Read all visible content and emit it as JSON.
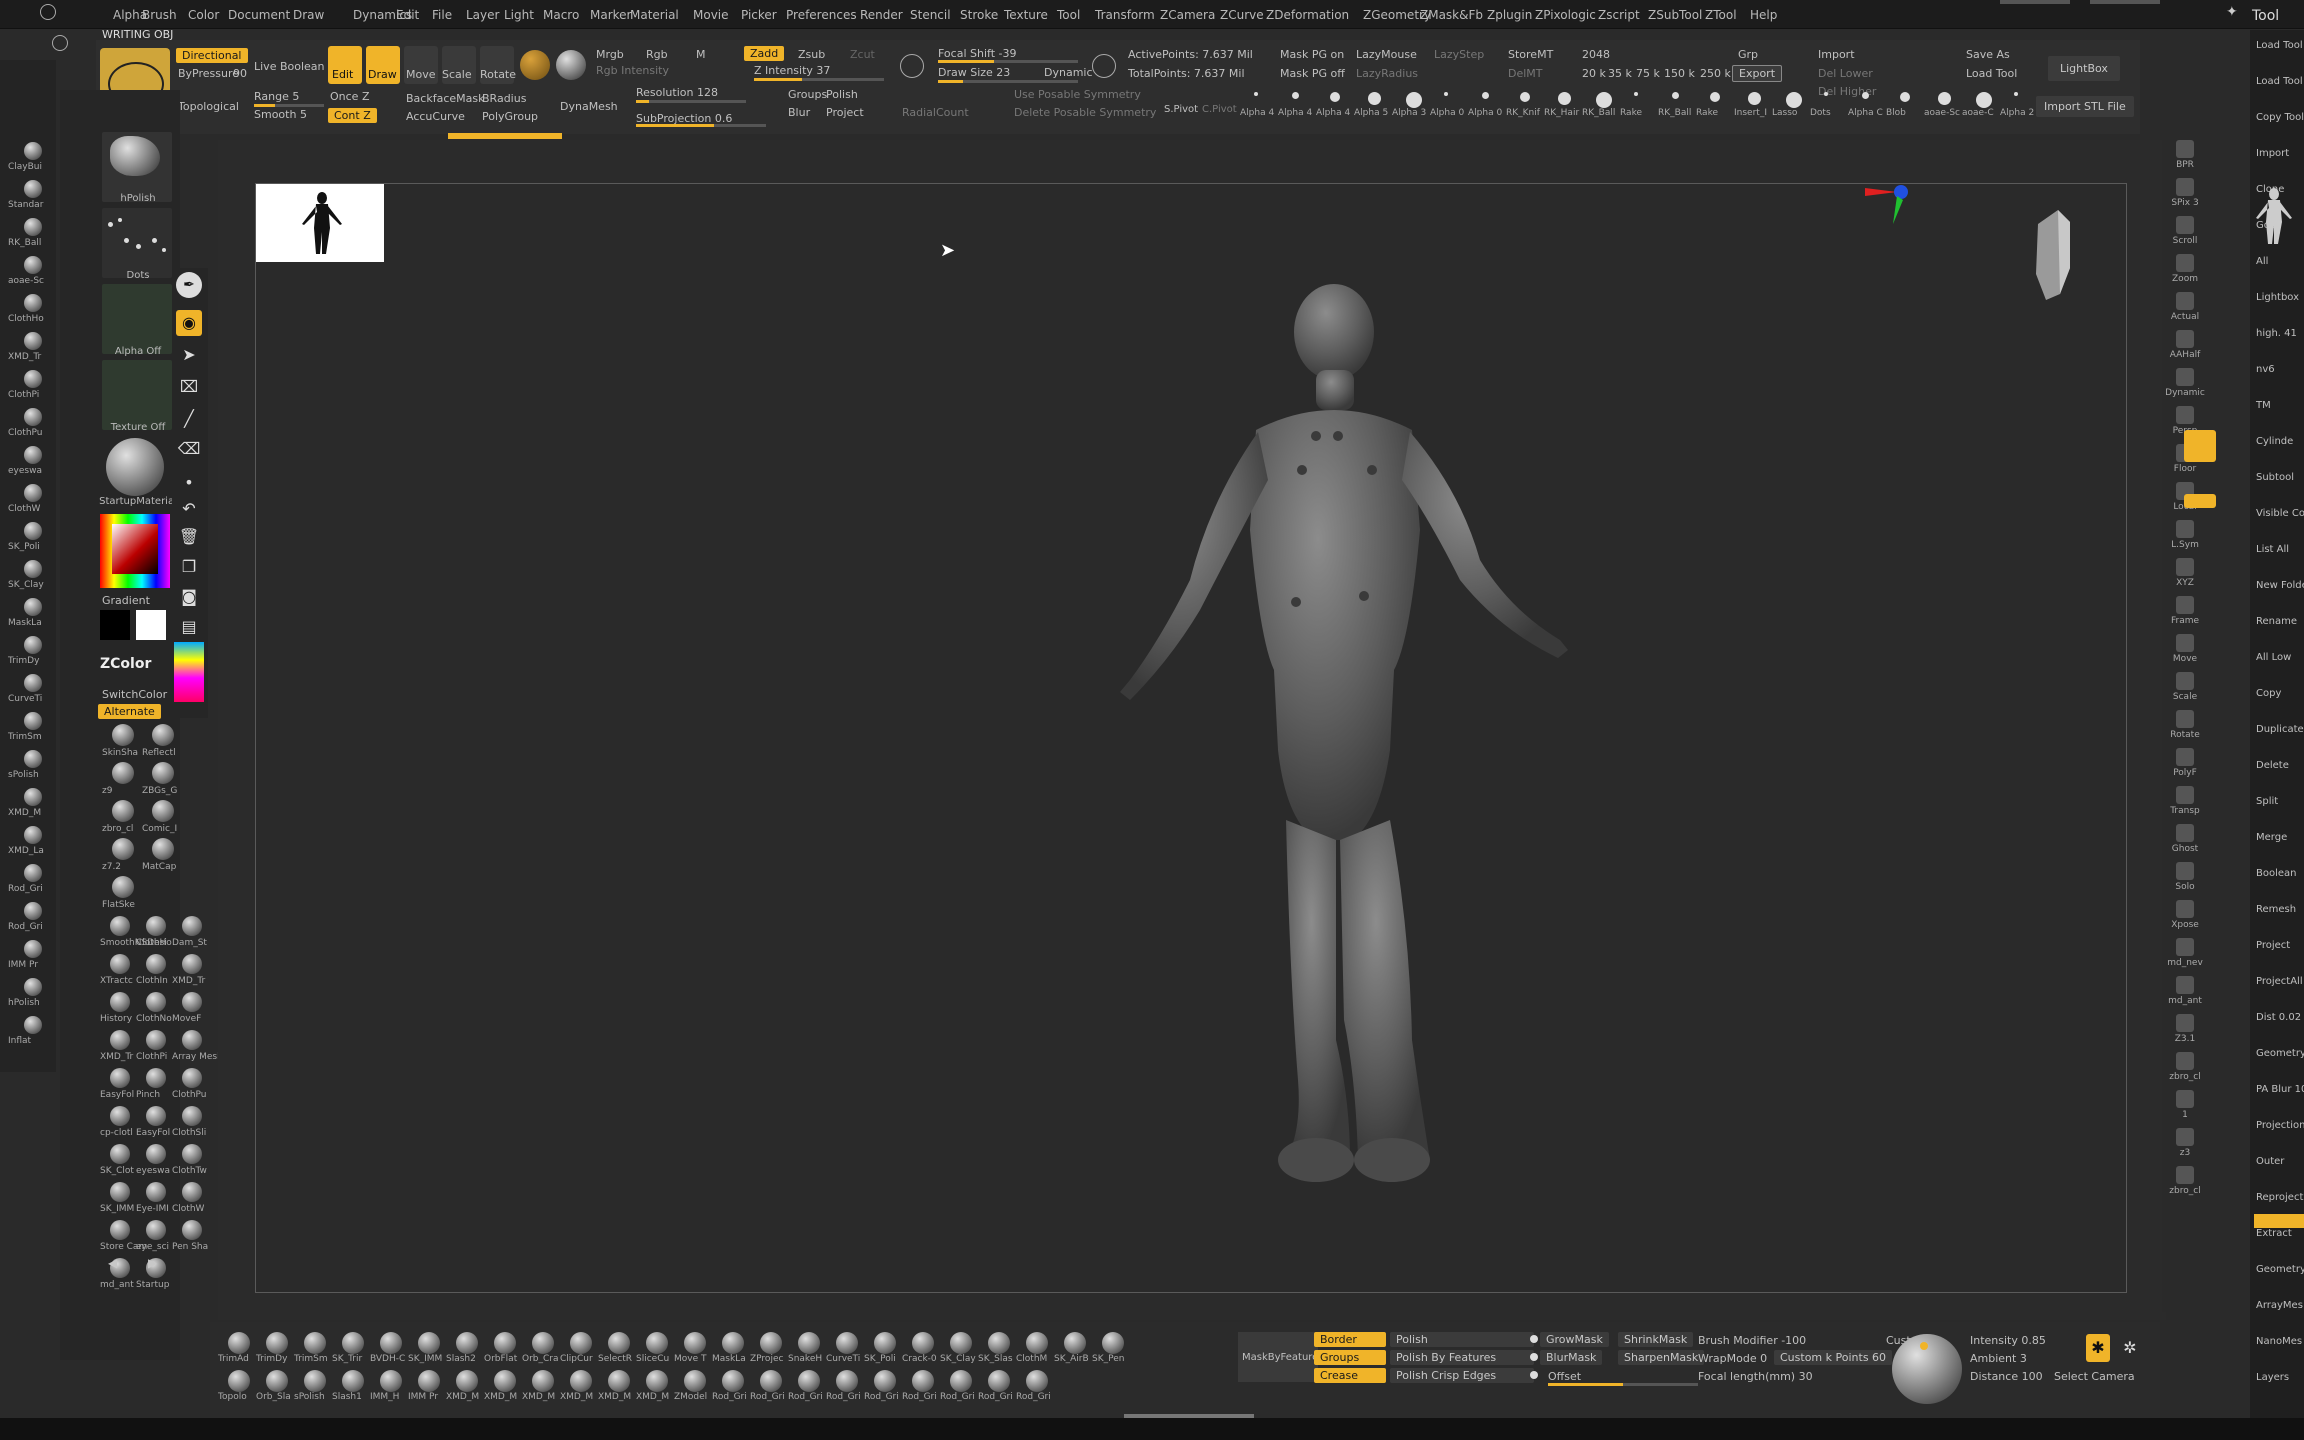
{
  "menu": [
    "Alpha",
    "Brush",
    "Color",
    "Document",
    "Draw",
    "Dynamics",
    "Edit",
    "File",
    "Layer",
    "Light",
    "Macro",
    "Marker",
    "Material",
    "Movie",
    "Picker",
    "Preferences",
    "Render",
    "Stencil",
    "Stroke",
    "Texture",
    "Tool",
    "Transform",
    "ZCamera",
    "ZCurve",
    "ZDeformation",
    "ZGeometry",
    "ZMask&Fb",
    "Zplugin",
    "ZPixologic",
    "Zscript",
    "ZSubTool",
    "ZTool",
    "Help"
  ],
  "tool_title": "Tool",
  "subtitle": "WRITING OBJ",
  "shelf": {
    "directional": "Directional",
    "bypressure": "ByPressure",
    "bypressure_val": "90",
    "live_boolean": "Live Boolean",
    "edit": "Edit",
    "draw": "Draw",
    "move": "Move",
    "scale": "Scale",
    "rotate": "Rotate",
    "mrgb": "Mrgb",
    "rgb": "Rgb",
    "m": "M",
    "rgb_intensity": "Rgb Intensity",
    "zadd": "Zadd",
    "zsub": "Zsub",
    "zcut": "Zcut",
    "z_intensity": "Z Intensity 37",
    "focal_shift": "Focal Shift -39",
    "draw_size": "Draw Size 23",
    "dynamic": "Dynamic",
    "active_points": "ActivePoints: 7.637 Mil",
    "total_points": "TotalPoints: 7.637 Mil",
    "mask_pg_on": "Mask PG on",
    "mask_pg_off": "Mask PG off",
    "lazymouse": "LazyMouse",
    "lazyradius": "LazyRadius",
    "lazystep": "LazyStep",
    "storemt": "StoreMT",
    "delmt": "DelMT",
    "res_2048": "2048",
    "grp": "Grp",
    "import": "Import",
    "export": "Export",
    "save_as": "Save As",
    "load_tool": "Load Tool",
    "lightbox": "LightBox",
    "del_lower": "Del Lower",
    "del_higher": "Del Higher",
    "counts": [
      "20 k",
      "35 k",
      "75 k",
      "150 k",
      "250 k"
    ],
    "topological": "Topological",
    "range": "Range 5",
    "smooth": "Smooth 5",
    "once_z": "Once Z",
    "cont_z": "Cont Z",
    "backface_mask": "BackfaceMask",
    "bradius": "BRadius",
    "accucurve": "AccuCurve",
    "polygroup": "PolyGroup",
    "dynamesh": "DynaMesh",
    "resolution": "Resolution 128",
    "subprojection": "SubProjection 0.6",
    "groups": "Groups",
    "polish": "Polish",
    "blur": "Blur",
    "project": "Project",
    "radial_count": "RadialCount",
    "use_posable_symmetry": "Use Posable Symmetry",
    "delete_posable_symmetry": "Delete Posable Symmetry",
    "spivot": "S.Pivot",
    "cpivot": "C.Pivot",
    "import_stl": "Import STL File",
    "alphas": [
      "Alpha 4",
      "Alpha 4",
      "Alpha 4",
      "Alpha 5",
      "Alpha 3",
      "Alpha 0",
      "Alpha 0",
      "RK_Knif",
      "RK_Hair",
      "RK_Ball",
      "Rake",
      "RK_Ball",
      "Rake",
      "Insert_I",
      "Lasso",
      "Dots",
      "Alpha C",
      "Blob",
      "aoae-Sc",
      "aoae-C",
      "Alpha 2"
    ]
  },
  "left": {
    "hpolish": "hPolish",
    "dots": "Dots",
    "alpha_off": "Alpha Off",
    "texture_off": "Texture Off",
    "startup_material": "StartupMaterial",
    "gradient": "Gradient",
    "switchcolor": "SwitchColor",
    "alternate": "Alternate",
    "zcolor": "ZColor",
    "materials": [
      "SkinSha",
      "Reflectl",
      "z9",
      "ZBGs_G",
      "zbro_cl",
      "Comic_I",
      "z7.2",
      "MatCap",
      "FlatSke"
    ],
    "brushes": [
      "SmoothNSDesi",
      "ClothHo",
      "Dam_St",
      "XTractc",
      "ClothIn",
      "XMD_Tr",
      "History",
      "ClothNo",
      "MoveF",
      "XMD_Tr",
      "ClothPi",
      "Array Mesh",
      "EasyFol",
      "Pinch",
      "ClothPu",
      "cp-clotl",
      "EasyFol",
      "ClothSli",
      "SK_Clot",
      "eyeswa",
      "ClothTw",
      "SK_IMM",
      "Eye-IMI",
      "ClothW",
      "Store Cam",
      "eye_sci",
      "Pen Sha",
      "md_ant",
      "Startup"
    ],
    "farleft": [
      "ClayBui",
      "Standar",
      "RK_Ball",
      "aoae-Sc",
      "ClothHo",
      "XMD_Tr",
      "ClothPi",
      "ClothPu",
      "eyeswa",
      "ClothW",
      "SK_Poli",
      "SK_Clay",
      "MaskLa",
      "TrimDy",
      "CurveTi",
      "TrimSm",
      "sPolish",
      "XMD_M",
      "XMD_La",
      "Rod_Gri",
      "Rod_Gri",
      "IMM Pr",
      "hPolish",
      "Inflat"
    ]
  },
  "right_tools": [
    "BPR",
    "SPix 3",
    "Scroll",
    "Zoom",
    "Actual",
    "AAHalf",
    "Dynamic",
    "Persp",
    "Floor",
    "Local",
    "L.Sym",
    "XYZ",
    "Frame",
    "Move",
    "Scale",
    "Rotate",
    "PolyF",
    "Transp",
    "Ghost",
    "Solo",
    "Xpose",
    "md_nev",
    "md_ant",
    "Z3.1",
    "zbro_cl",
    "1",
    "z3",
    "zbro_cl"
  ],
  "right_panel": [
    "Load Tool",
    "Load Tool",
    "Copy Tool",
    "Import",
    "Clone",
    "GoZ",
    "All",
    "Lightbox",
    "high. 41",
    "nv6",
    "TM",
    "Cylinde",
    "Subtool",
    "Visible Co",
    "List All",
    "New Folde",
    "Rename",
    "All Low",
    "Copy",
    "Duplicate",
    "Delete",
    "Split",
    "Merge",
    "Boolean",
    "Remesh",
    "Project",
    "ProjectAll",
    "Dist 0.02",
    "Geometry",
    "PA Blur 10",
    "Projection",
    "Outer",
    "Reproject",
    "Extract",
    "Geometry",
    "ArrayMes",
    "NanoMes",
    "Layers"
  ],
  "bottom": {
    "brushes_row1": [
      "TrimAd",
      "TrimDy",
      "TrimSm",
      "SK_Trir",
      "BVDH-C",
      "SK_IMM",
      "Slash2",
      "OrbFlat",
      "Orb_Cra",
      "ClipCur",
      "SelectR",
      "SliceCu",
      "Move T",
      "MaskLa",
      "ZProjec",
      "SnakeH",
      "CurveTi",
      "SK_Poli",
      "Crack-0",
      "SK_Clay",
      "SK_Slas",
      "ClothM",
      "SK_AirB",
      "SK_Pen"
    ],
    "brushes_row2": [
      "Topolo",
      "Orb_Sla",
      "sPolish",
      "Slash1",
      "IMM_H",
      "IMM Pr",
      "XMD_M",
      "XMD_M",
      "XMD_M",
      "XMD_M",
      "XMD_M",
      "XMD_M",
      "ZModel",
      "Rod_Gri",
      "Rod_Gri",
      "Rod_Gri",
      "Rod_Gri",
      "Rod_Gri",
      "Rod_Gri",
      "Rod_Gri",
      "Rod_Gri",
      "Rod_Gri"
    ],
    "maskbyfeature": "MaskByFeature",
    "border": "Border",
    "groups": "Groups",
    "crease": "Crease",
    "polish": "Polish",
    "polish_by_features": "Polish By Features",
    "polish_crisp_edges": "Polish Crisp Edges",
    "growmask": "GrowMask",
    "shrinkmask": "ShrinkMask",
    "blurmask": "BlurMask",
    "sharpenmask": "SharpenMask",
    "offset": "Offset",
    "brush_modifier": "Brush Modifier -100",
    "wrapmode": "WrapMode 0",
    "custom_k_points": "Custom k Points 60",
    "custom": "Custom",
    "focal_length": "Focal length(mm) 30",
    "intensity": "Intensity 0.85",
    "ambient": "Ambient 3",
    "distance": "Distance 100",
    "select_camera": "Select Camera"
  },
  "colors": {
    "accent": "#f0b429",
    "background": "#2a2a2a"
  }
}
